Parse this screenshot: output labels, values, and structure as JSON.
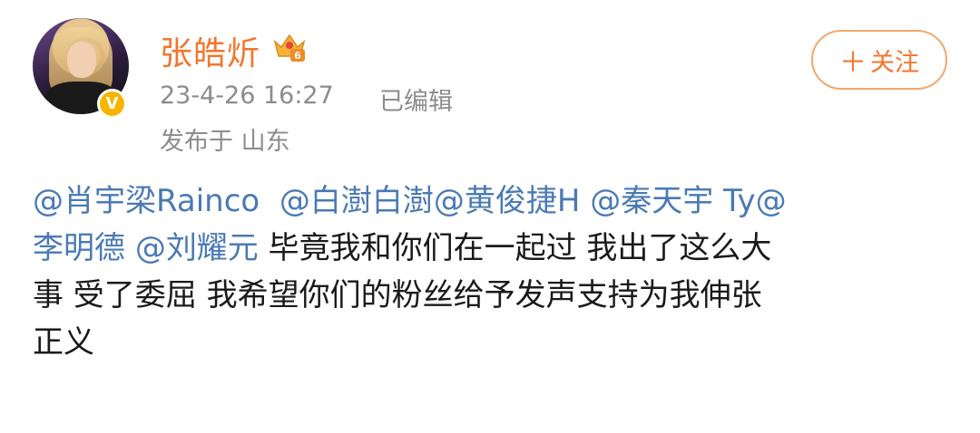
{
  "header": {
    "username": "张皓炘",
    "crown_icon": "crown-level-6-icon",
    "crown_level": "6",
    "timestamp": "23-4-26 16:27",
    "edited": "已编辑",
    "location": "发布于 山东",
    "verified_badge": "V",
    "follow_button": {
      "plus": "＋",
      "label": "关注"
    }
  },
  "content": {
    "line1": [
      {
        "type": "mention",
        "text": "@肖宇梁Rainco"
      },
      {
        "type": "text",
        "text": "  "
      },
      {
        "type": "mention",
        "text": "@白澍白澍"
      },
      {
        "type": "mention",
        "text": "@黄俊捷H"
      },
      {
        "type": "text",
        "text": " "
      },
      {
        "type": "mention",
        "text": "@秦天宇 Ty@"
      }
    ],
    "line2_mention1": "李明德",
    "line2_mention2": "@刘耀元",
    "line2_text": " 毕竟我和你们在一起过 我出了这么大",
    "line3": "事 受了委屈 我希望你们的粉丝给予发声支持为我伸张",
    "line4": "正义"
  },
  "colors": {
    "username": "#f2762e",
    "mention": "#4a7ab5",
    "meta": "#8c8c8c",
    "follow_border": "#f2a86b",
    "badge": "#f7b500"
  }
}
